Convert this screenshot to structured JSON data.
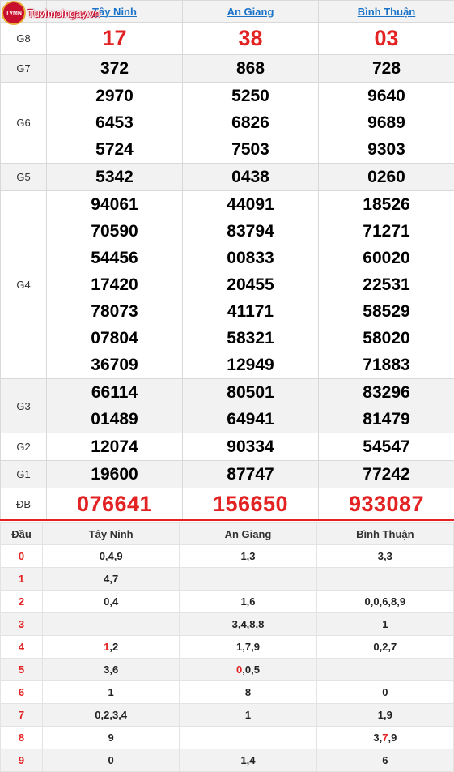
{
  "logo": {
    "badge_text": "TVMN",
    "site": "Tuvimoingay.vn"
  },
  "provinces": [
    "Tây Ninh",
    "An Giang",
    "Bình Thuận"
  ],
  "prizes": [
    {
      "label": "G8",
      "values": [
        [
          "17"
        ],
        [
          "38"
        ],
        [
          "03"
        ]
      ]
    },
    {
      "label": "G7",
      "values": [
        [
          "372"
        ],
        [
          "868"
        ],
        [
          "728"
        ]
      ]
    },
    {
      "label": "G6",
      "values": [
        [
          "2970",
          "6453",
          "5724"
        ],
        [
          "5250",
          "6826",
          "7503"
        ],
        [
          "9640",
          "9689",
          "9303"
        ]
      ]
    },
    {
      "label": "G5",
      "values": [
        [
          "5342"
        ],
        [
          "0438"
        ],
        [
          "0260"
        ]
      ]
    },
    {
      "label": "G4",
      "values": [
        [
          "94061",
          "70590",
          "54456",
          "17420",
          "78073",
          "07804",
          "36709"
        ],
        [
          "44091",
          "83794",
          "00833",
          "20455",
          "41171",
          "58321",
          "12949"
        ],
        [
          "18526",
          "71271",
          "60020",
          "22531",
          "58529",
          "58020",
          "71883"
        ]
      ]
    },
    {
      "label": "G3",
      "values": [
        [
          "66114",
          "01489"
        ],
        [
          "80501",
          "64941"
        ],
        [
          "83296",
          "81479"
        ]
      ]
    },
    {
      "label": "G2",
      "values": [
        [
          "12074"
        ],
        [
          "90334"
        ],
        [
          "54547"
        ]
      ]
    },
    {
      "label": "G1",
      "values": [
        [
          "19600"
        ],
        [
          "87747"
        ],
        [
          "77242"
        ]
      ]
    },
    {
      "label": "ĐB",
      "values": [
        [
          "076641"
        ],
        [
          "156650"
        ],
        [
          "933087"
        ]
      ]
    }
  ],
  "loto": {
    "header": [
      "Đầu",
      "Tây Ninh",
      "An Giang",
      "Bình Thuận"
    ],
    "rows": [
      {
        "head": "0",
        "cols": [
          "0,4,9",
          "1,3",
          "3,3"
        ]
      },
      {
        "head": "1",
        "cols": [
          "4,7",
          "",
          ""
        ]
      },
      {
        "head": "2",
        "cols": [
          "0,4",
          "1,6",
          "0,0,6,8,9"
        ]
      },
      {
        "head": "3",
        "cols": [
          "",
          "3,4,8,8",
          "1"
        ]
      },
      {
        "head": "4",
        "cols": [
          "1,2",
          "1,7,9",
          "0,2,7"
        ]
      },
      {
        "head": "5",
        "cols": [
          "3,6",
          "0,0,5",
          ""
        ]
      },
      {
        "head": "6",
        "cols": [
          "1",
          "8",
          "0"
        ]
      },
      {
        "head": "7",
        "cols": [
          "0,2,3,4",
          "1",
          "1,9"
        ]
      },
      {
        "head": "8",
        "cols": [
          "9",
          "",
          "3,7,9"
        ]
      },
      {
        "head": "9",
        "cols": [
          "0",
          "1,4",
          "6"
        ]
      }
    ]
  },
  "colors": {
    "accent_red": "#e32323",
    "link_blue": "#1a73c8",
    "row_alt": "#f2f2f2"
  }
}
